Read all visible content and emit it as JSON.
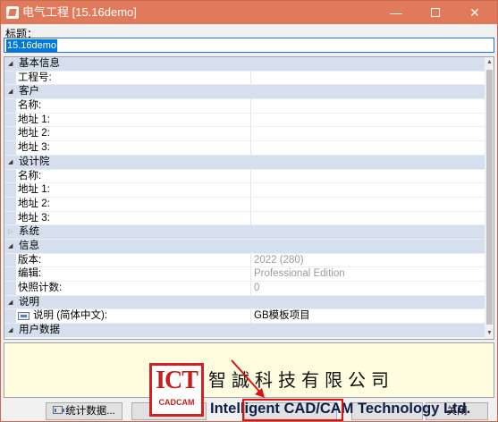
{
  "window": {
    "title": "电气工程 [15.16demo]",
    "controls": {
      "minimize": "—",
      "maximize": "",
      "close": "✕"
    }
  },
  "title_field": {
    "label": "标题：",
    "value": "15.16demo"
  },
  "grid": {
    "categories": {
      "basic": {
        "label": "基本信息",
        "project_no": "工程号:"
      },
      "customer": {
        "label": "客户",
        "name": "名称:",
        "addr1": "地址 1:",
        "addr2": "地址 2:",
        "addr3": "地址 3:"
      },
      "design": {
        "label": "设计院",
        "name": "名称:",
        "addr1": "地址 1:",
        "addr2": "地址 2:",
        "addr3": "地址 3:"
      },
      "system": {
        "label": "系统"
      },
      "info": {
        "label": "信息",
        "version_label": "版本:",
        "version_value": "2022 (280)",
        "edition_label": "编辑:",
        "edition_value": "Professional Edition",
        "snapshot_label": "快照计数:",
        "snapshot_value": "0"
      },
      "description": {
        "label": "说明",
        "desc_label": "说明 (简体中文):",
        "desc_value": "GB模板项目"
      },
      "user_data": {
        "label": "用户数据"
      }
    }
  },
  "buttons": {
    "stats": "统计数据...",
    "b2": "",
    "b3": "",
    "b4": "",
    "b5": "关闭"
  },
  "watermark": {
    "logo": "ICT",
    "logo_sub": "CADCAM",
    "cn": "智誠科技有限公司",
    "en": "Intelligent CAD/CAM Technology Ltd."
  },
  "colors": {
    "titlebar": "#e07a5a",
    "category_bg": "#d5dfed",
    "selection": "#0078d7",
    "description_pane": "#fffde0",
    "annotation": "#e01010"
  },
  "icons": {
    "app": "app-icon",
    "language": "language-flag-icon",
    "stats": "chart-icon"
  }
}
